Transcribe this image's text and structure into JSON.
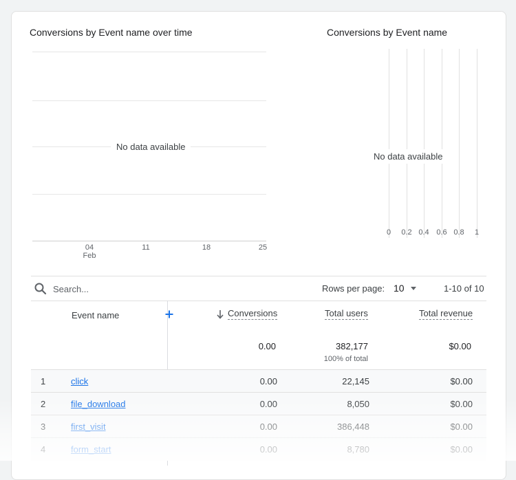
{
  "line_chart": {
    "title": "Conversions by Event name over time",
    "no_data": "No data available",
    "x_ticks": [
      {
        "label": "04",
        "sub": "Feb"
      },
      {
        "label": "11",
        "sub": ""
      },
      {
        "label": "18",
        "sub": ""
      },
      {
        "label": "25",
        "sub": ""
      }
    ]
  },
  "bar_chart": {
    "title": "Conversions by Event name",
    "no_data": "No data available",
    "x_ticks": [
      "0",
      "0.2",
      "0.4",
      "0.6",
      "0.8",
      "1"
    ]
  },
  "toolbar": {
    "search_placeholder": "Search...",
    "rows_per_page_label": "Rows per page:",
    "rows_per_page_value": "10",
    "pagination": "1-10 of 10"
  },
  "table": {
    "headers": {
      "event_name": "Event name",
      "conversions": "Conversions",
      "total_users": "Total users",
      "total_revenue": "Total revenue"
    },
    "totals": {
      "conversions": "0.00",
      "total_users": "382,177",
      "total_users_sub": "100% of total",
      "total_revenue": "$0.00"
    },
    "rows": [
      {
        "index": "1",
        "event": "click",
        "conversions": "0.00",
        "users": "22,145",
        "revenue": "$0.00"
      },
      {
        "index": "2",
        "event": "file_download",
        "conversions": "0.00",
        "users": "8,050",
        "revenue": "$0.00"
      },
      {
        "index": "3",
        "event": "first_visit",
        "conversions": "0.00",
        "users": "386,448",
        "revenue": "$0.00"
      },
      {
        "index": "4",
        "event": "form_start",
        "conversions": "0.00",
        "users": "8,780",
        "revenue": "$0.00"
      }
    ]
  },
  "colors": {
    "link": "#1a73e8",
    "add_icon": "#1a73e8",
    "row_bg": "#f8f9fa"
  }
}
